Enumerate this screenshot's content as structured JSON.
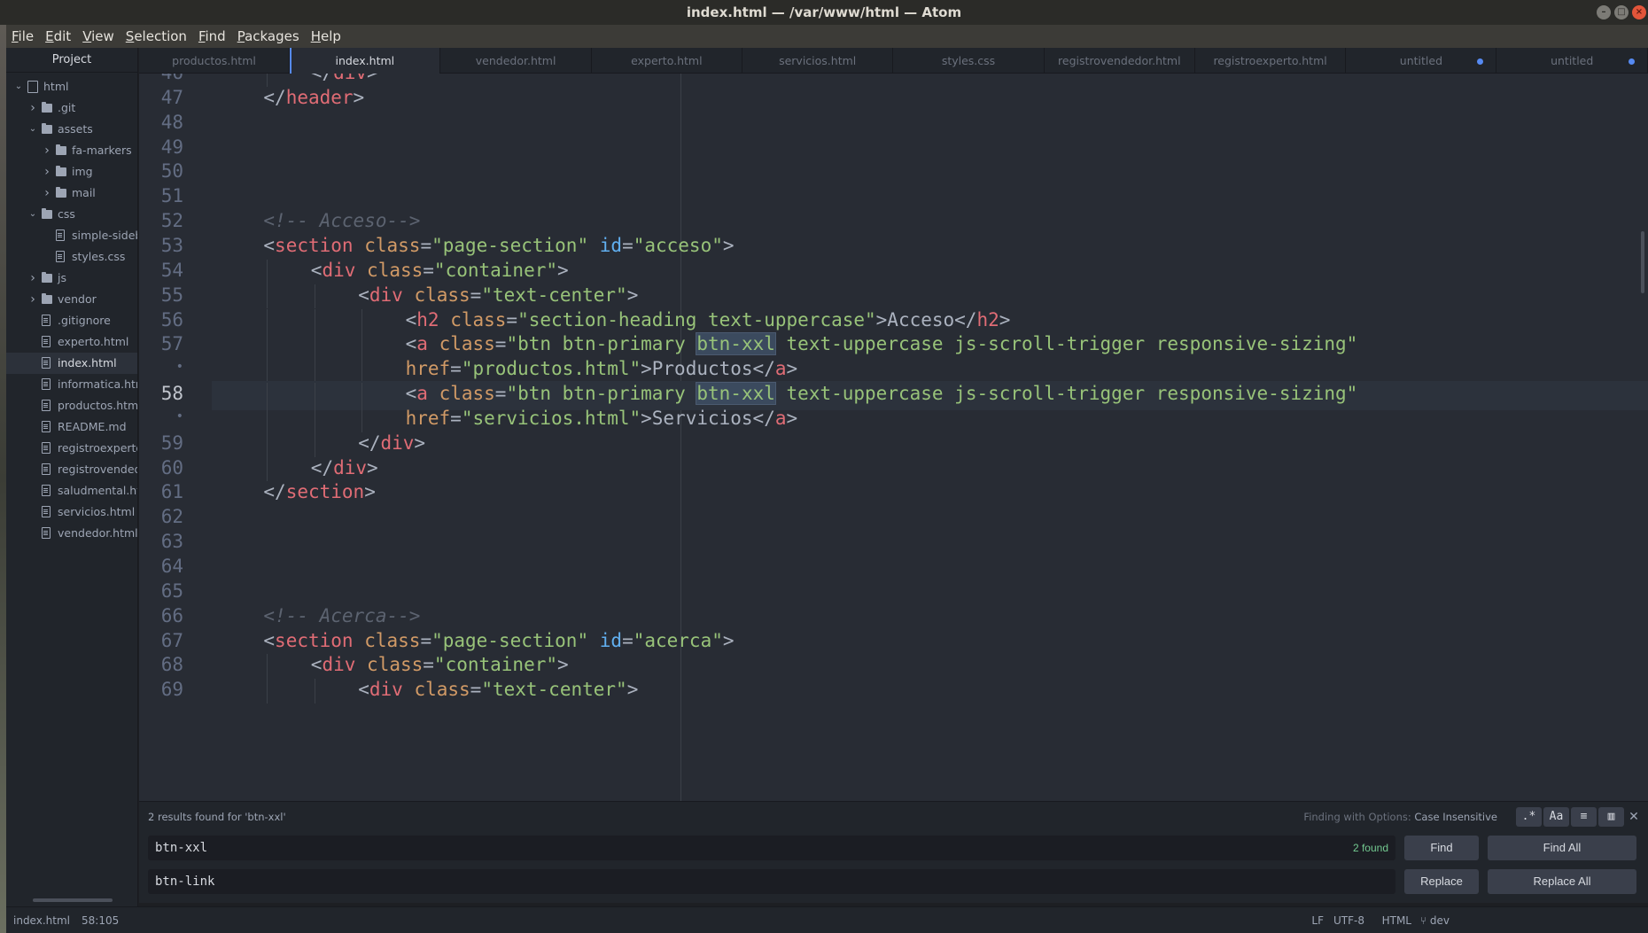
{
  "window": {
    "title": "index.html — /var/www/html — Atom"
  },
  "menu": [
    "File",
    "Edit",
    "View",
    "Selection",
    "Find",
    "Packages",
    "Help"
  ],
  "tree": {
    "header": "Project",
    "items": [
      {
        "label": "html",
        "type": "repo",
        "level": 0,
        "expanded": true
      },
      {
        "label": ".git",
        "type": "folder",
        "level": 1,
        "expanded": false
      },
      {
        "label": "assets",
        "type": "folder",
        "level": 1,
        "expanded": true
      },
      {
        "label": "fa-markers",
        "type": "folder",
        "level": 2,
        "expanded": false
      },
      {
        "label": "img",
        "type": "folder",
        "level": 2,
        "expanded": false
      },
      {
        "label": "mail",
        "type": "folder",
        "level": 2,
        "expanded": false
      },
      {
        "label": "css",
        "type": "folder",
        "level": 1,
        "expanded": true
      },
      {
        "label": "simple-sidebar.css",
        "type": "file",
        "level": 2
      },
      {
        "label": "styles.css",
        "type": "file",
        "level": 2
      },
      {
        "label": "js",
        "type": "folder",
        "level": 1,
        "expanded": false
      },
      {
        "label": "vendor",
        "type": "folder",
        "level": 1,
        "expanded": false
      },
      {
        "label": ".gitignore",
        "type": "file",
        "level": 1
      },
      {
        "label": "experto.html",
        "type": "file",
        "level": 1
      },
      {
        "label": "index.html",
        "type": "file",
        "level": 1,
        "selected": true
      },
      {
        "label": "informatica.html",
        "type": "file",
        "level": 1
      },
      {
        "label": "productos.html",
        "type": "file",
        "level": 1
      },
      {
        "label": "README.md",
        "type": "readme",
        "level": 1
      },
      {
        "label": "registroexperto.html",
        "type": "file",
        "level": 1
      },
      {
        "label": "registrovendedor.html",
        "type": "file",
        "level": 1
      },
      {
        "label": "saludmental.html",
        "type": "file",
        "level": 1
      },
      {
        "label": "servicios.html",
        "type": "file",
        "level": 1
      },
      {
        "label": "vendedor.html",
        "type": "file",
        "level": 1
      }
    ]
  },
  "tabs": [
    {
      "label": "productos.html"
    },
    {
      "label": "index.html",
      "active": true
    },
    {
      "label": "vendedor.html"
    },
    {
      "label": "experto.html"
    },
    {
      "label": "servicios.html"
    },
    {
      "label": "styles.css"
    },
    {
      "label": "registrovendedor.html"
    },
    {
      "label": "registroexperto.html"
    },
    {
      "label": "untitled",
      "modified": true
    },
    {
      "label": "untitled",
      "modified": true
    }
  ],
  "editor": {
    "lines": [
      {
        "num": "46",
        "indent": 4,
        "tokens": [
          [
            "p",
            "</"
          ],
          [
            "tag",
            "div"
          ],
          [
            "p",
            ">"
          ]
        ]
      },
      {
        "num": "47",
        "indent": 2,
        "tokens": [
          [
            "p",
            "</"
          ],
          [
            "tag",
            "header"
          ],
          [
            "p",
            ">"
          ]
        ]
      },
      {
        "num": "48",
        "indent": 0,
        "tokens": []
      },
      {
        "num": "49",
        "indent": 0,
        "tokens": []
      },
      {
        "num": "50",
        "indent": 0,
        "tokens": []
      },
      {
        "num": "51",
        "indent": 0,
        "tokens": []
      },
      {
        "num": "52",
        "indent": 2,
        "tokens": [
          [
            "cmt",
            "<!-- Acceso-->"
          ]
        ]
      },
      {
        "num": "53",
        "indent": 2,
        "tokens": [
          [
            "p",
            "<"
          ],
          [
            "tag",
            "section"
          ],
          [
            "p",
            " "
          ],
          [
            "attr",
            "class"
          ],
          [
            "p",
            "="
          ],
          [
            "str",
            "\"page-section\""
          ],
          [
            "p",
            " "
          ],
          [
            "idattr",
            "id"
          ],
          [
            "p",
            "="
          ],
          [
            "str",
            "\"acceso\""
          ],
          [
            "p",
            ">"
          ]
        ]
      },
      {
        "num": "54",
        "indent": 4,
        "tokens": [
          [
            "p",
            "<"
          ],
          [
            "tag",
            "div"
          ],
          [
            "p",
            " "
          ],
          [
            "attr",
            "class"
          ],
          [
            "p",
            "="
          ],
          [
            "str",
            "\"container\""
          ],
          [
            "p",
            ">"
          ]
        ]
      },
      {
        "num": "55",
        "indent": 6,
        "tokens": [
          [
            "p",
            "<"
          ],
          [
            "tag",
            "div"
          ],
          [
            "p",
            " "
          ],
          [
            "attr",
            "class"
          ],
          [
            "p",
            "="
          ],
          [
            "str",
            "\"text-center\""
          ],
          [
            "p",
            ">"
          ]
        ]
      },
      {
        "num": "56",
        "indent": 8,
        "tokens": [
          [
            "p",
            "<"
          ],
          [
            "tag",
            "h2"
          ],
          [
            "p",
            " "
          ],
          [
            "attr",
            "class"
          ],
          [
            "p",
            "="
          ],
          [
            "str",
            "\"section-heading text-uppercase\""
          ],
          [
            "p",
            ">Acceso</"
          ],
          [
            "tag",
            "h2"
          ],
          [
            "p",
            ">"
          ]
        ]
      },
      {
        "num": "57",
        "indent": 8,
        "tokens": [
          [
            "p",
            "<"
          ],
          [
            "tag",
            "a"
          ],
          [
            "p",
            " "
          ],
          [
            "attr",
            "class"
          ],
          [
            "p",
            "="
          ],
          [
            "str",
            "\"btn btn-primary "
          ],
          [
            "hlstr",
            "btn-xxl"
          ],
          [
            "str",
            " text-uppercase js-scroll-trigger responsive-sizing\""
          ]
        ]
      },
      {
        "num": "•",
        "indent": 8,
        "wrap": true,
        "tokens": [
          [
            "attr",
            "href"
          ],
          [
            "p",
            "="
          ],
          [
            "str",
            "\"productos.html\""
          ],
          [
            "p",
            ">Productos</"
          ],
          [
            "tag",
            "a"
          ],
          [
            "p",
            ">"
          ]
        ]
      },
      {
        "num": "58",
        "indent": 8,
        "current": true,
        "tokens": [
          [
            "p",
            "<"
          ],
          [
            "tag",
            "a"
          ],
          [
            "p",
            " "
          ],
          [
            "attr",
            "class"
          ],
          [
            "p",
            "="
          ],
          [
            "str",
            "\"btn btn-primary "
          ],
          [
            "hlstr",
            "btn-xxl"
          ],
          [
            "str",
            " text-uppercase js-scroll-trigger responsive-sizing\""
          ]
        ]
      },
      {
        "num": "•",
        "indent": 8,
        "wrap": true,
        "tokens": [
          [
            "attr",
            "href"
          ],
          [
            "p",
            "="
          ],
          [
            "str",
            "\"servicios.html\""
          ],
          [
            "p",
            ">Servicios</"
          ],
          [
            "tag",
            "a"
          ],
          [
            "p",
            ">"
          ]
        ]
      },
      {
        "num": "59",
        "indent": 6,
        "tokens": [
          [
            "p",
            "</"
          ],
          [
            "tag",
            "div"
          ],
          [
            "p",
            ">"
          ]
        ]
      },
      {
        "num": "60",
        "indent": 4,
        "tokens": [
          [
            "p",
            "</"
          ],
          [
            "tag",
            "div"
          ],
          [
            "p",
            ">"
          ]
        ]
      },
      {
        "num": "61",
        "indent": 2,
        "tokens": [
          [
            "p",
            "</"
          ],
          [
            "tag",
            "section"
          ],
          [
            "p",
            ">"
          ]
        ]
      },
      {
        "num": "62",
        "indent": 0,
        "tokens": []
      },
      {
        "num": "63",
        "indent": 0,
        "tokens": []
      },
      {
        "num": "64",
        "indent": 0,
        "tokens": []
      },
      {
        "num": "65",
        "indent": 0,
        "tokens": []
      },
      {
        "num": "66",
        "indent": 2,
        "tokens": [
          [
            "cmt",
            "<!-- Acerca-->"
          ]
        ]
      },
      {
        "num": "67",
        "indent": 2,
        "tokens": [
          [
            "p",
            "<"
          ],
          [
            "tag",
            "section"
          ],
          [
            "p",
            " "
          ],
          [
            "attr",
            "class"
          ],
          [
            "p",
            "="
          ],
          [
            "str",
            "\"page-section\""
          ],
          [
            "p",
            " "
          ],
          [
            "idattr",
            "id"
          ],
          [
            "p",
            "="
          ],
          [
            "str",
            "\"acerca\""
          ],
          [
            "p",
            ">"
          ]
        ]
      },
      {
        "num": "68",
        "indent": 4,
        "tokens": [
          [
            "p",
            "<"
          ],
          [
            "tag",
            "div"
          ],
          [
            "p",
            " "
          ],
          [
            "attr",
            "class"
          ],
          [
            "p",
            "="
          ],
          [
            "str",
            "\"container\""
          ],
          [
            "p",
            ">"
          ]
        ]
      },
      {
        "num": "69",
        "indent": 6,
        "tokens": [
          [
            "p",
            "<"
          ],
          [
            "tag",
            "div"
          ],
          [
            "p",
            " "
          ],
          [
            "attr",
            "class"
          ],
          [
            "p",
            "="
          ],
          [
            "str",
            "\"text-center\""
          ],
          [
            "p",
            ">"
          ]
        ]
      }
    ]
  },
  "find": {
    "description": "2 results found for 'btn-xxl'",
    "options_prefix": "Finding with Options: ",
    "options_value": "Case Insensitive",
    "option_buttons": [
      ".*",
      "Aa",
      "≡",
      "▥"
    ],
    "find_value": "btn-xxl",
    "found_count": "2 found",
    "replace_value": "btn-link",
    "find_button": "Find",
    "find_all_button": "Find All",
    "replace_button": "Replace",
    "replace_all_button": "Replace All"
  },
  "status": {
    "file": "index.html",
    "cursor": "58:105",
    "line_ending": "LF",
    "encoding": "UTF-8",
    "grammar": "HTML",
    "branch": "dev"
  }
}
